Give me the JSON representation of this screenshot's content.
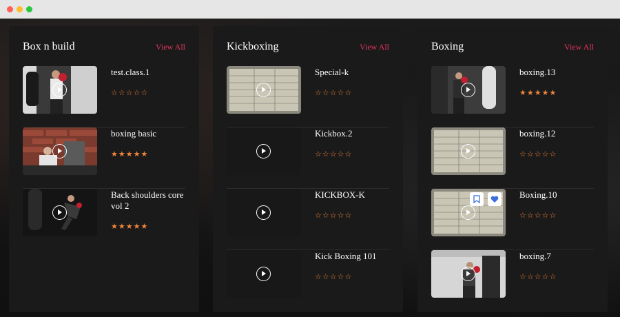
{
  "panels": [
    {
      "title": "Box n build",
      "view_all": "View All",
      "items": [
        {
          "name": "test.class.1",
          "rating": 0,
          "stars": "☆☆☆☆☆"
        },
        {
          "name": "boxing basic",
          "rating": 5,
          "stars": "★★★★★"
        },
        {
          "name": "Back shoulders core vol 2",
          "rating": 5,
          "stars": "★★★★★"
        }
      ]
    },
    {
      "title": "Kickboxing",
      "view_all": "View All",
      "items": [
        {
          "name": "Special-k",
          "rating": 0,
          "stars": "☆☆☆☆☆"
        },
        {
          "name": "Kickbox.2",
          "rating": 0,
          "stars": "☆☆☆☆☆"
        },
        {
          "name": "KICKBOX-K",
          "rating": 0,
          "stars": "☆☆☆☆☆"
        },
        {
          "name": "Kick Boxing 101",
          "rating": 0,
          "stars": "☆☆☆☆☆"
        }
      ]
    },
    {
      "title": "Boxing",
      "view_all": "View All",
      "items": [
        {
          "name": "boxing.13",
          "rating": 5,
          "stars": "★★★★★"
        },
        {
          "name": "boxing.12",
          "rating": 0,
          "stars": "☆☆☆☆☆"
        },
        {
          "name": "Boxing.10",
          "rating": 0,
          "stars": "☆☆☆☆☆"
        },
        {
          "name": "boxing.7",
          "rating": 0,
          "stars": "☆☆☆☆☆"
        }
      ]
    }
  ],
  "icons": {
    "play": "play-circle-icon",
    "bookmark": "bookmark-icon",
    "heart": "heart-icon",
    "star_filled": "star-filled-icon",
    "star_empty": "star-outline-icon"
  },
  "colors": {
    "accent": "#e5345e",
    "star": "#f0843a",
    "heart": "#3b6fe0",
    "panel_bg": "#1a1a1a"
  }
}
